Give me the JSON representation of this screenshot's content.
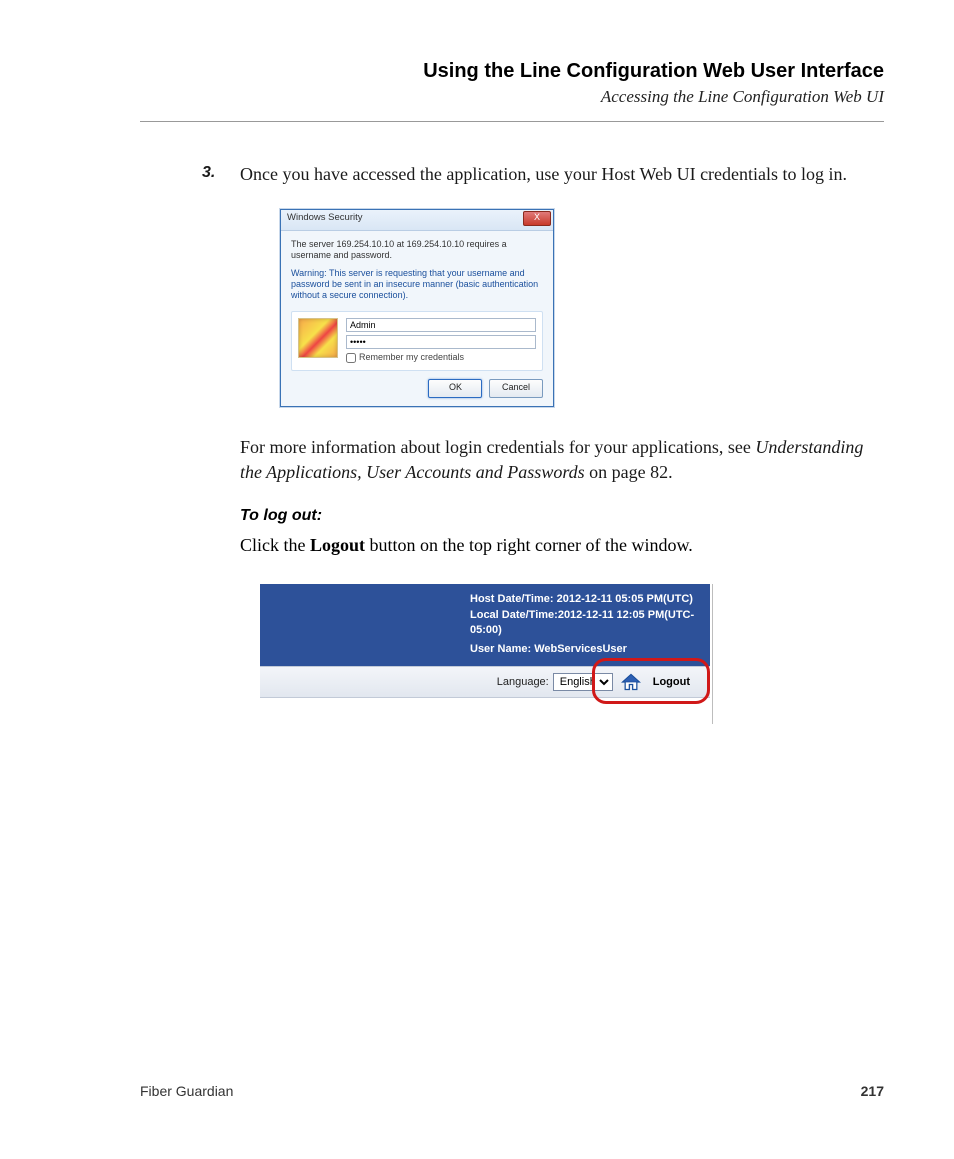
{
  "header": {
    "title": "Using the Line Configuration Web User Interface",
    "subtitle": "Accessing the Line Configuration Web UI"
  },
  "step": {
    "num": "3.",
    "text": "Once you have accessed the application, use your Host Web UI credentials to log in."
  },
  "dialog": {
    "title": "Windows Security",
    "close": "X",
    "msg1": "The server 169.254.10.10 at 169.254.10.10 requires a username and password.",
    "msg2": "Warning: This server is requesting that your username and password be sent in an insecure manner (basic authentication without a secure connection).",
    "username": "Admin",
    "password": "•••••",
    "remember": "Remember my credentials",
    "ok": "OK",
    "cancel": "Cancel"
  },
  "para2a": "For more information about login credentials for your applications, see ",
  "para2b": "Understanding the Applications, User Accounts and Passwords",
  "para2c": " on page 82.",
  "subhead": "To log out:",
  "para3a": "Click the ",
  "para3b": "Logout",
  "para3c": " button on the top right corner of the window.",
  "webui": {
    "host_dt": "Host Date/Time: 2012-12-11 05:05 PM(UTC)",
    "local_dt": "Local Date/Time:2012-12-11 12:05 PM(UTC-05:00)",
    "user": "User Name: WebServicesUser",
    "lang_label": "Language:",
    "lang_value": "English",
    "logout": "Logout"
  },
  "footer": {
    "product": "Fiber Guardian",
    "page": "217"
  }
}
